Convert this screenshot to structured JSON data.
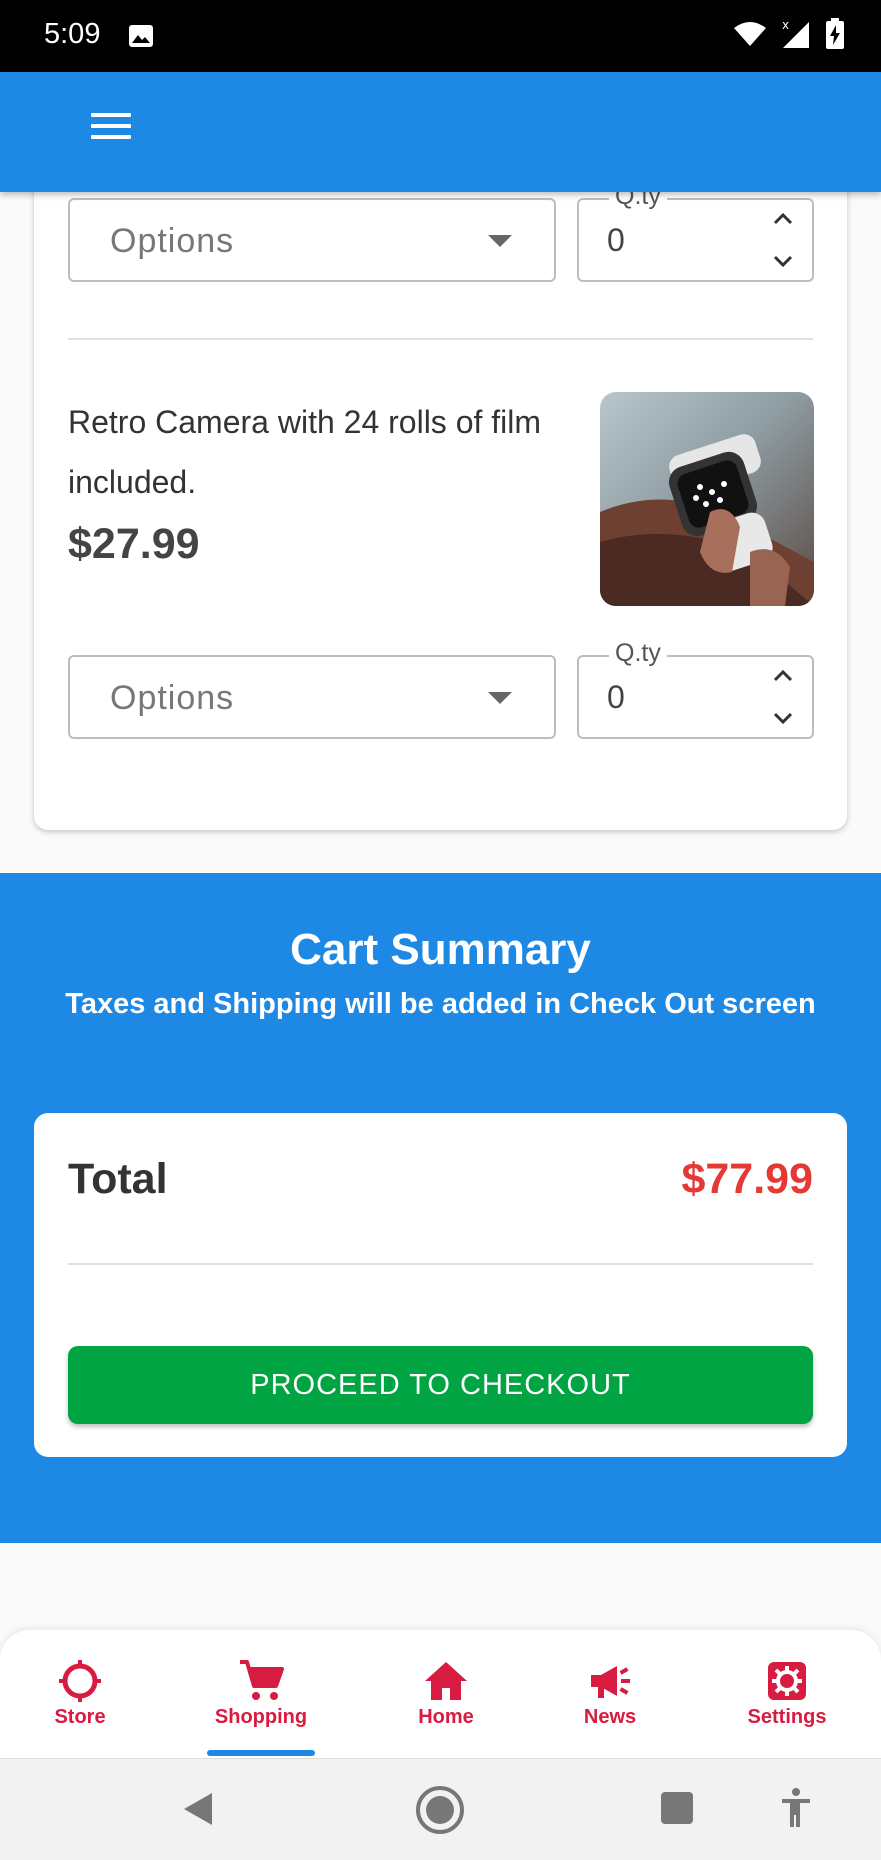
{
  "status_bar": {
    "time": "5:09",
    "icons": [
      "image-icon",
      "wifi-icon",
      "signal-icon",
      "battery-charging-icon"
    ]
  },
  "app_bar": {
    "menu_icon": "hamburger-menu-icon",
    "color": "#1e88e5"
  },
  "product_top": {
    "options_label": "Options",
    "qty_label": "Q.ty",
    "qty_value": "0"
  },
  "product": {
    "title": "Retro Camera with 24 rolls of film included.",
    "price": "$27.99",
    "image": "smartwatch-photo",
    "options_label": "Options",
    "qty_label": "Q.ty",
    "qty_value": "0"
  },
  "summary": {
    "title": "Cart Summary",
    "subtitle": "Taxes and Shipping will be added in Check Out screen",
    "total_label": "Total",
    "total_value": "$77.99",
    "checkout_label": "PROCEED TO CHECKOUT",
    "colors": {
      "background": "#1e88e5",
      "total": "#e53935",
      "checkout": "#00a443"
    }
  },
  "bottom_nav": {
    "active": "Shopping",
    "accent": "#d81b40",
    "items": [
      {
        "label": "Store",
        "icon": "target-icon"
      },
      {
        "label": "Shopping",
        "icon": "cart-icon"
      },
      {
        "label": "Home",
        "icon": "home-icon"
      },
      {
        "label": "News",
        "icon": "megaphone-icon"
      },
      {
        "label": "Settings",
        "icon": "settings-icon"
      }
    ]
  },
  "system_nav": {
    "buttons": [
      "back-icon",
      "home-circle-icon",
      "recents-icon",
      "accessibility-icon"
    ]
  }
}
